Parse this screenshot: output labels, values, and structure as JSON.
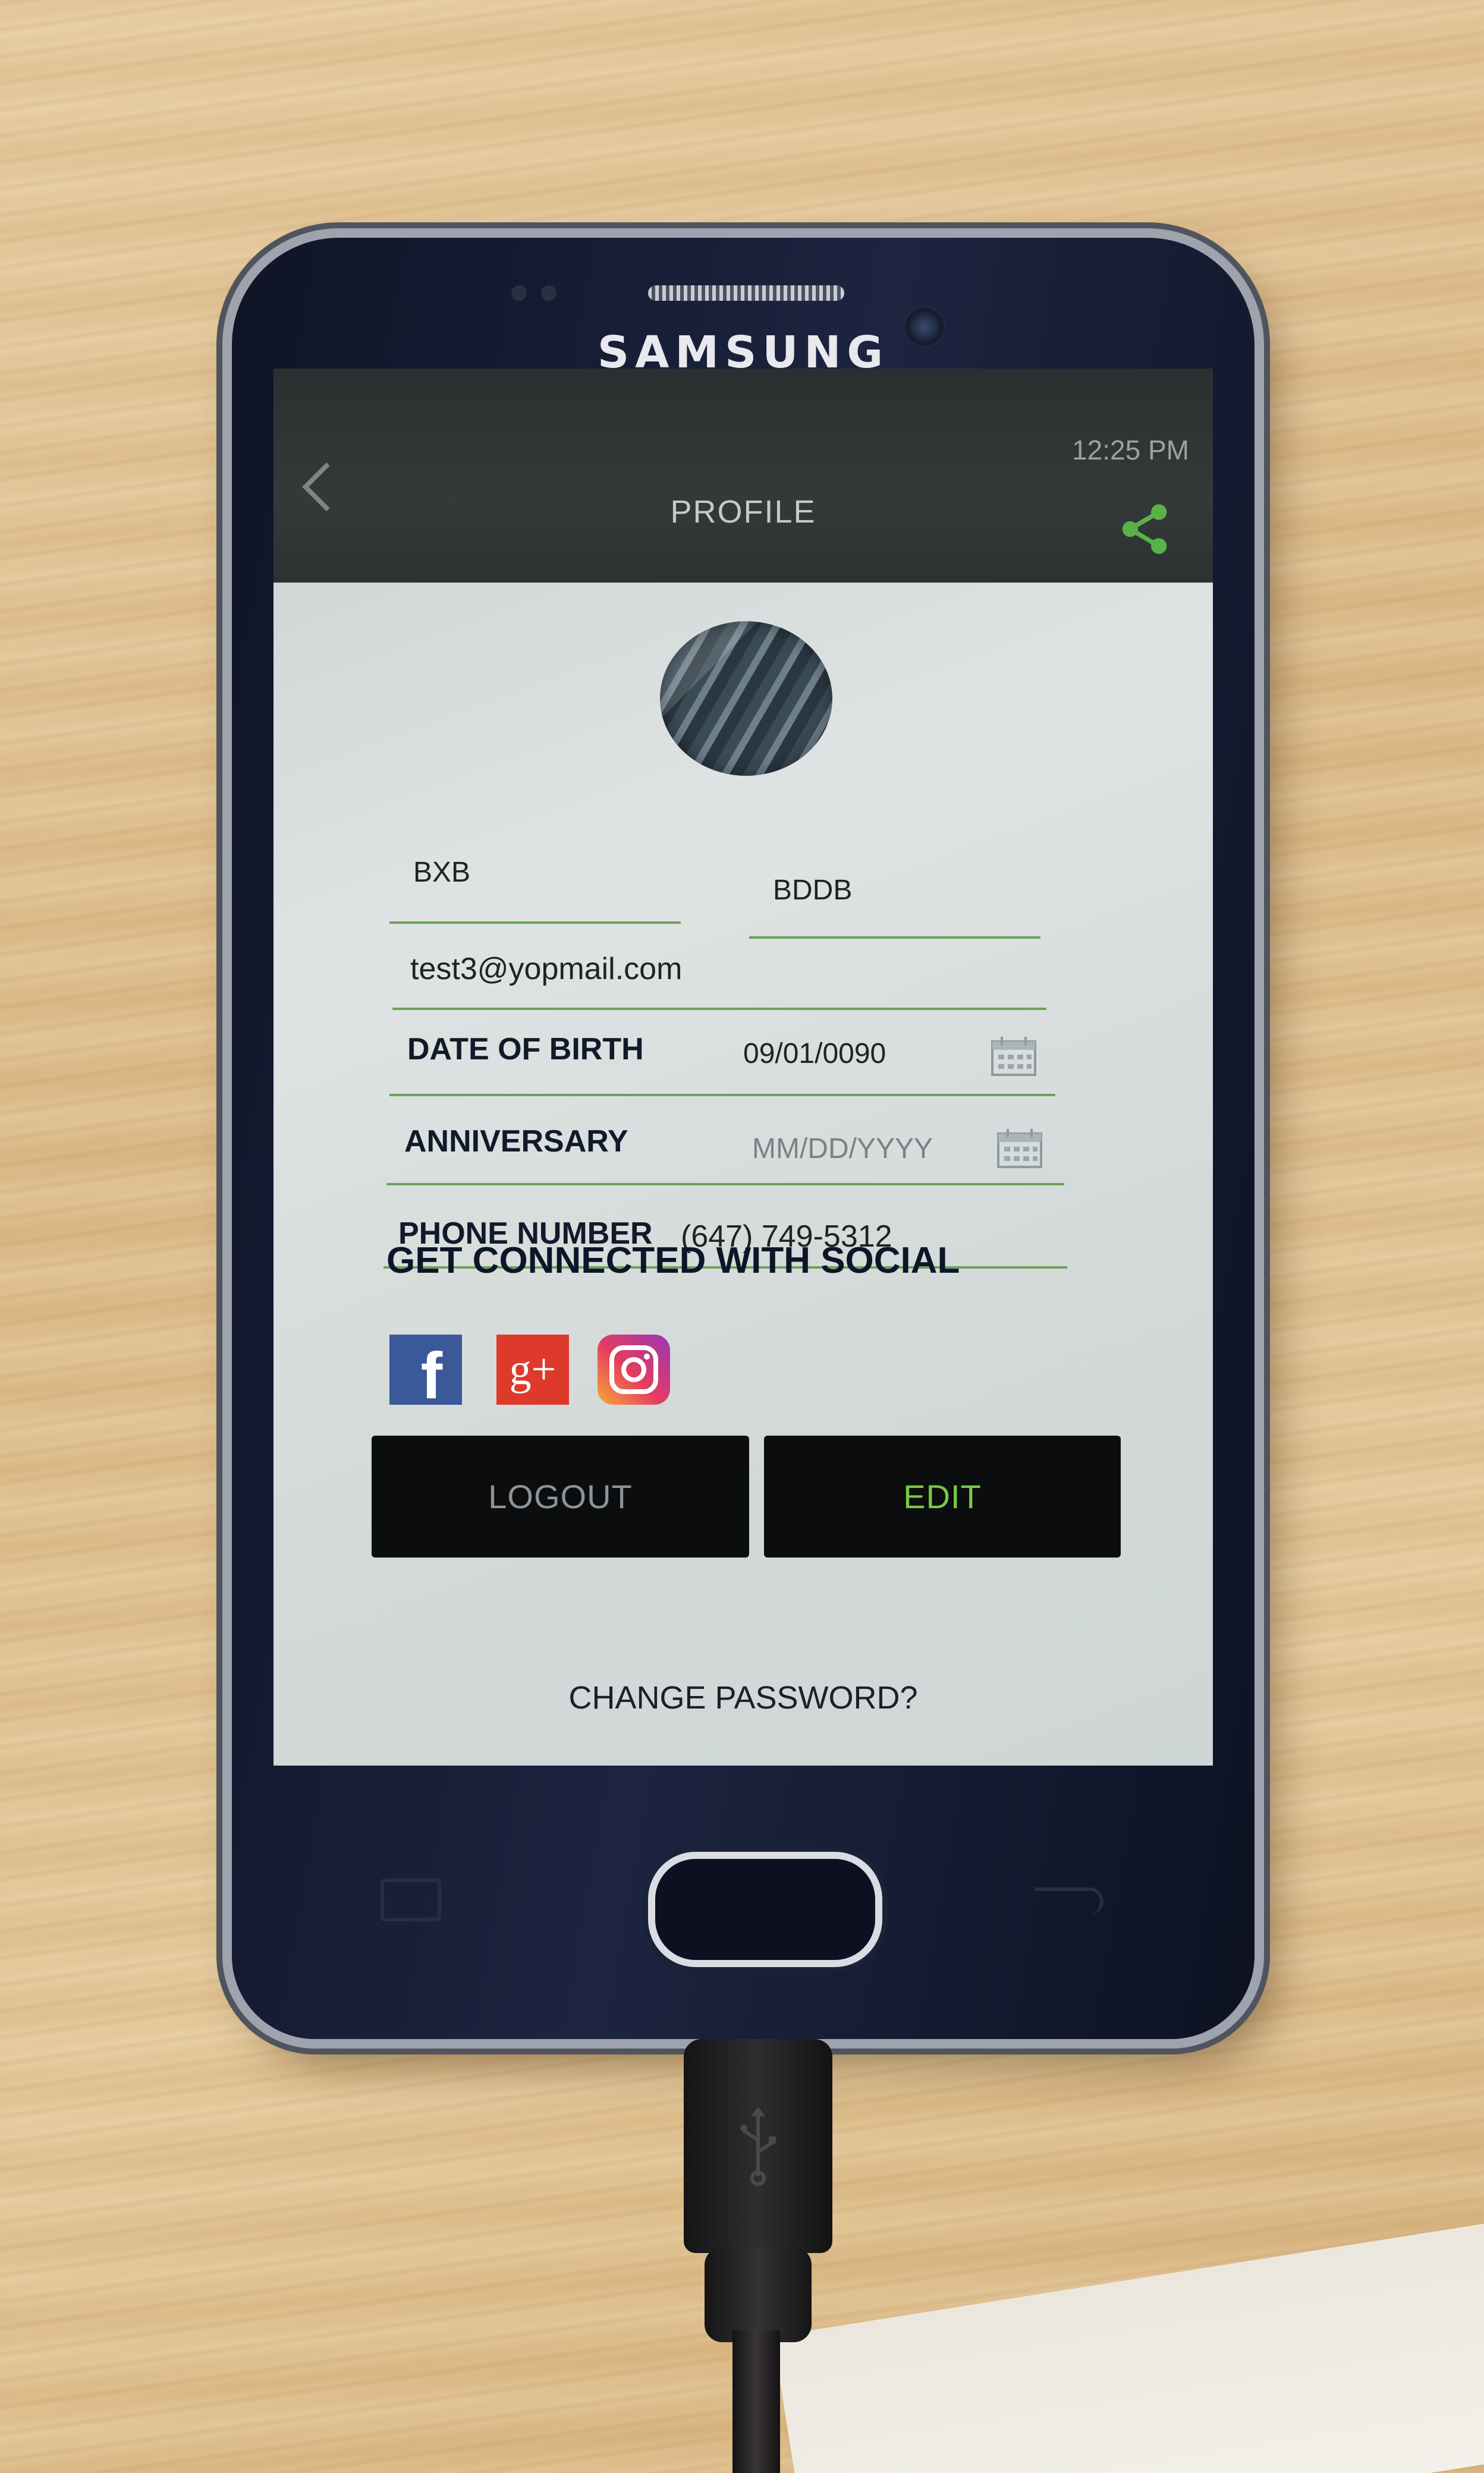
{
  "device": {
    "brand": "SAMSUNG"
  },
  "status_bar": {
    "time": "12:25 PM"
  },
  "app_bar": {
    "title": "PROFILE",
    "back_icon": "back-chevron-icon",
    "share_icon": "share-icon"
  },
  "profile": {
    "first_name": "BXB",
    "last_name": "BDDB",
    "email": "test3@yopmail.com",
    "date_of_birth": {
      "label": "DATE OF BIRTH",
      "value": "09/01/0090",
      "icon": "calendar-icon"
    },
    "anniversary": {
      "label": "ANNIVERSARY",
      "placeholder": "MM/DD/YYYY",
      "icon": "calendar-icon"
    },
    "phone": {
      "label": "PHONE NUMBER",
      "value": "(647) 749-5312"
    }
  },
  "social": {
    "heading": "GET CONNECTED WITH SOCIAL",
    "icons": [
      "facebook-icon",
      "google-plus-icon",
      "instagram-icon"
    ],
    "facebook_glyph": "f",
    "google_plus_glyph": "g+"
  },
  "actions": {
    "logout_label": "LOGOUT",
    "edit_label": "EDIT",
    "change_password_label": "CHANGE PASSWORD?"
  },
  "colors": {
    "underline": "#6aa25c",
    "edit_text": "#7ac943",
    "logout_text": "#8d9396",
    "button_bg": "#0b0d0e",
    "share_icon": "#59b14a",
    "facebook": "#3b5998",
    "google_plus": "#dd3a2c"
  }
}
